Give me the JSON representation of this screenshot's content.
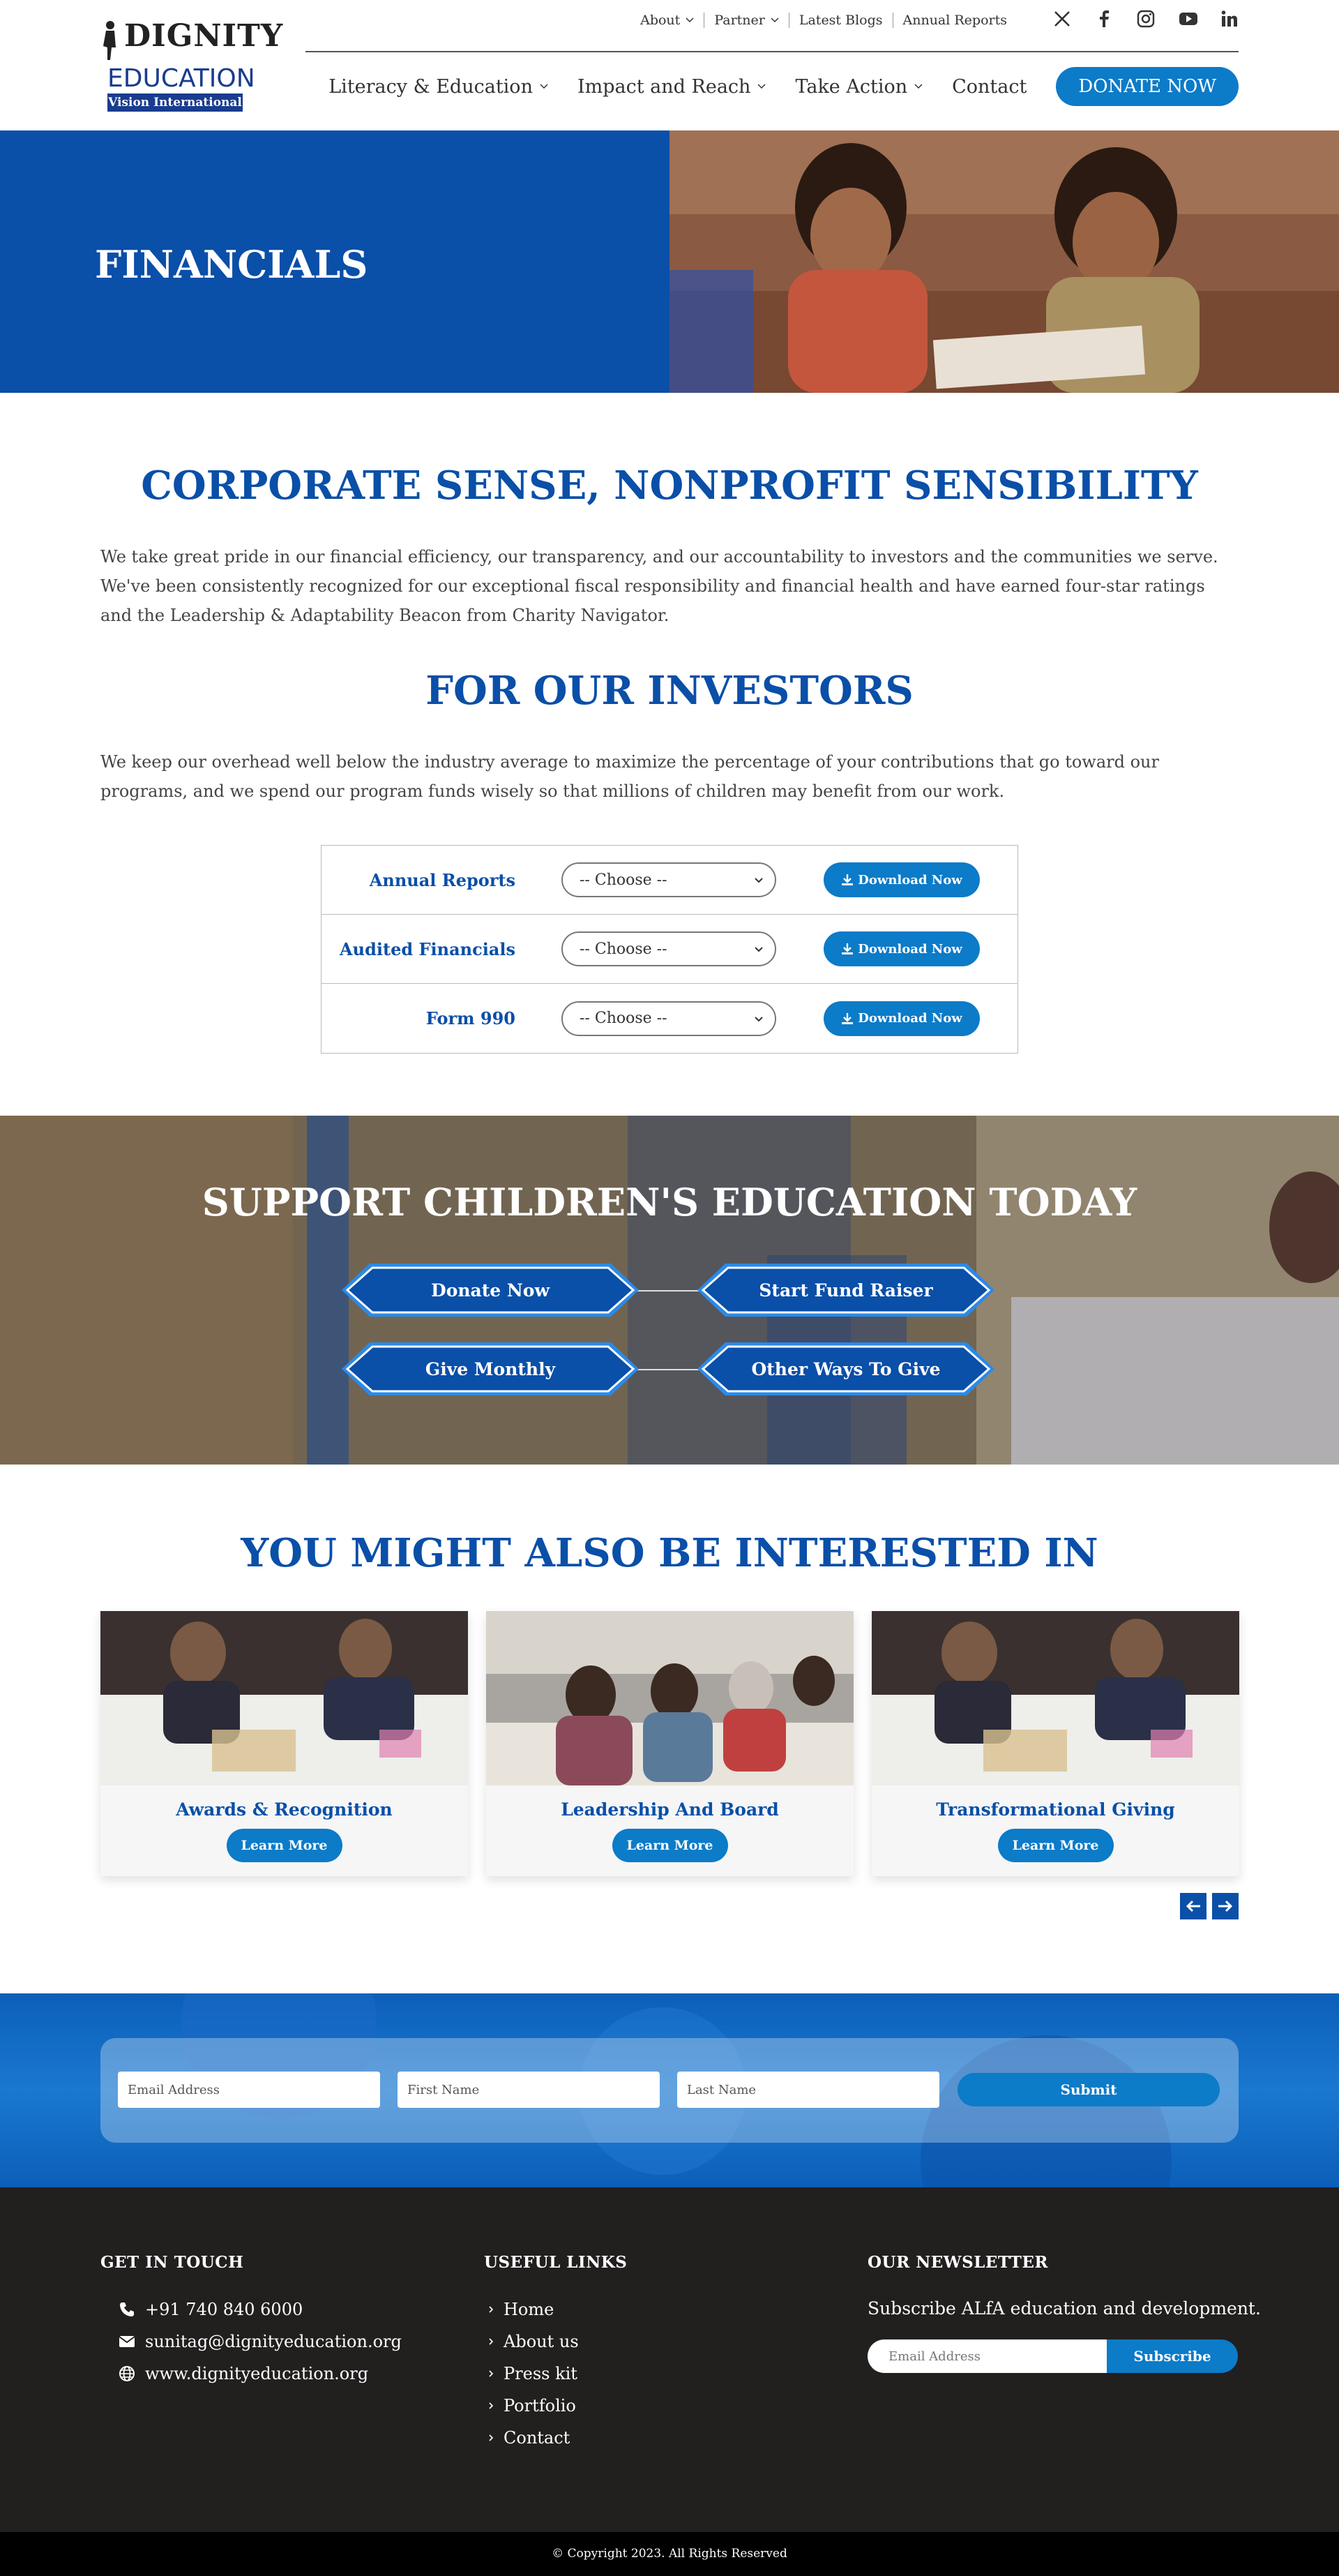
{
  "header": {
    "logo": {
      "word1": "DIGNITY",
      "word2": "EDUCATION",
      "word3": "Vision International"
    },
    "top_nav": [
      {
        "label": "About",
        "dropdown": true
      },
      {
        "label": "Partner",
        "dropdown": true
      },
      {
        "label": "Latest Blogs",
        "dropdown": false
      },
      {
        "label": "Annual Reports",
        "dropdown": false
      }
    ],
    "social_icons": [
      "x-icon",
      "facebook-icon",
      "instagram-icon",
      "youtube-icon",
      "linkedin-icon"
    ],
    "main_nav": [
      {
        "label": "Literacy & Education",
        "dropdown": true
      },
      {
        "label": "Impact and Reach",
        "dropdown": true
      },
      {
        "label": "Take Action",
        "dropdown": true
      },
      {
        "label": "Contact",
        "dropdown": false
      }
    ],
    "donate_label": "DONATE NOW"
  },
  "hero": {
    "title": "FINANCIALS"
  },
  "section1": {
    "title": "CORPORATE SENSE, NONPROFIT SENSIBILITY",
    "text": "We take great pride in our financial efficiency, our transparency, and our accountability to investors and the communities we serve. We've been consistently recognized for our exceptional fiscal responsibility and financial health and have earned four-star ratings and the Leadership & Adaptability Beacon from Charity Navigator."
  },
  "section2": {
    "title": "FOR OUR INVESTORS",
    "text": "We keep our overhead well below the industry average to maximize the percentage of your contributions that go toward our programs, and we spend our program funds wisely so that millions of children may benefit from our work.",
    "rows": [
      {
        "label": "Annual Reports",
        "select": "-- Choose --",
        "button": "Download Now"
      },
      {
        "label": "Audited Financials",
        "select": "-- Choose --",
        "button": "Download Now"
      },
      {
        "label": "Form 990",
        "select": "-- Choose --",
        "button": "Download Now"
      }
    ]
  },
  "support": {
    "title": "SUPPORT CHILDREN'S EDUCATION TODAY",
    "buttons": [
      "Donate Now",
      "Start Fund Raiser",
      "Give Monthly",
      "Other Ways To Give"
    ]
  },
  "interest": {
    "title": "YOU MIGHT ALSO BE INTERESTED IN",
    "cards": [
      {
        "title": "Awards & Recognition",
        "button": "Learn More"
      },
      {
        "title": "Leadership And Board",
        "button": "Learn More"
      },
      {
        "title": "Transformational Giving",
        "button": "Learn More"
      }
    ]
  },
  "signup": {
    "email_placeholder": "Email Address",
    "first_placeholder": "First Name",
    "last_placeholder": "Last Name",
    "submit": "Submit"
  },
  "footer": {
    "contact": {
      "title": "GET IN TOUCH",
      "phone": "+91 740 840 6000",
      "email": "sunitag@dignityeducation.org",
      "web": "www.dignityeducation.org"
    },
    "links": {
      "title": "USEFUL LINKS",
      "items": [
        "Home",
        "About us",
        "Press kit",
        "Portfolio",
        "Contact"
      ]
    },
    "newsletter": {
      "title": "OUR NEWSLETTER",
      "text": "Subscribe ALfA education and development.",
      "placeholder": "Email Address",
      "button": "Subscribe"
    },
    "copyright": "© Copyright 2023. All Rights Reserved"
  },
  "colors": {
    "brand_blue": "#0a4fa8",
    "button_blue": "#0c7bc8",
    "footer_bg": "#221f1f"
  }
}
